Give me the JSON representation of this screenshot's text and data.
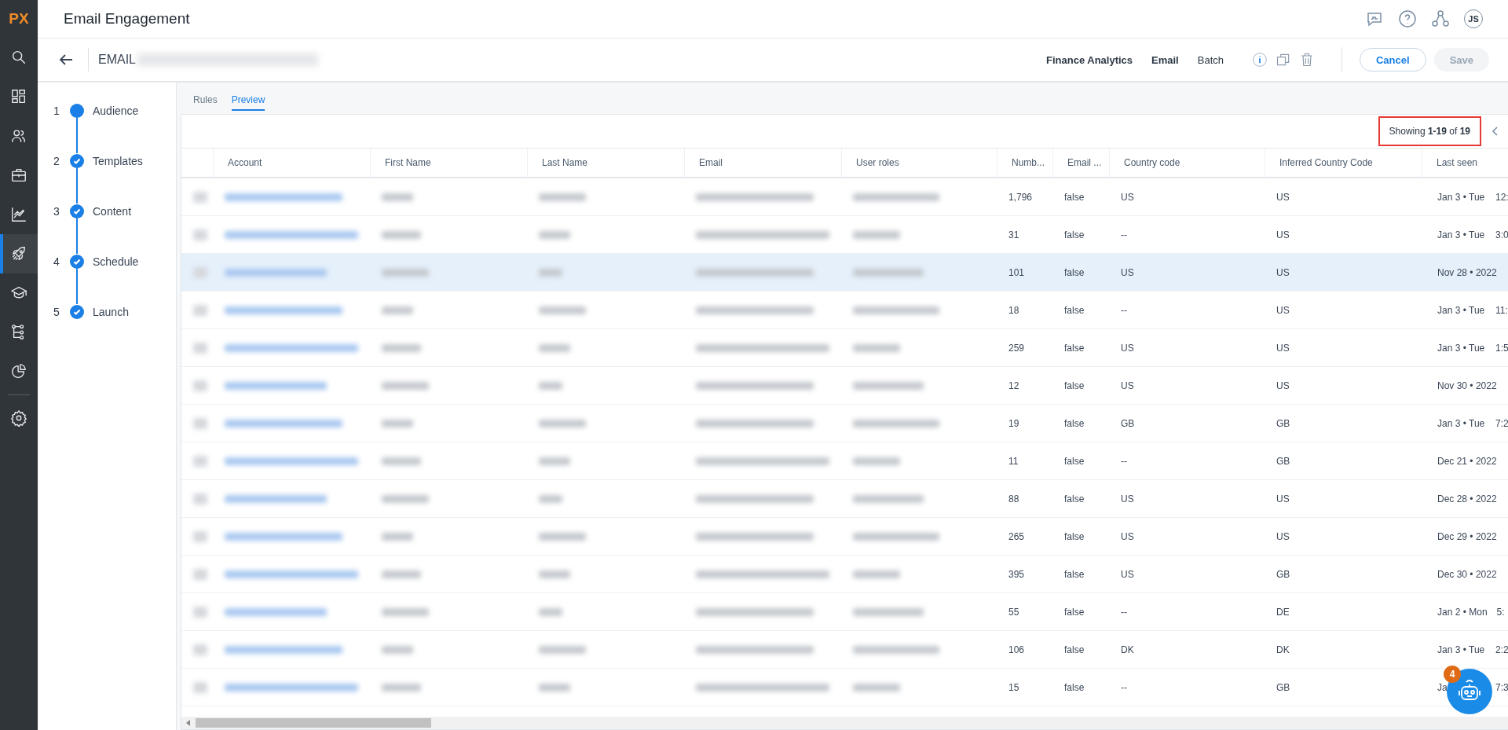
{
  "logo": "PX",
  "sidebar": {
    "items": [
      {
        "selected": false
      },
      {
        "selected": false
      },
      {
        "selected": false
      },
      {
        "selected": false
      },
      {
        "selected": false
      },
      {
        "selected": true
      },
      {
        "selected": false
      },
      {
        "selected": false
      },
      {
        "selected": false
      },
      {
        "selected": false
      }
    ]
  },
  "header": {
    "title": "Email Engagement",
    "avatar": "JS"
  },
  "subheader": {
    "name": "EMAIL",
    "tags": [
      {
        "label": "Finance Analytics",
        "bold": true
      },
      {
        "label": "Email",
        "bold": true
      },
      {
        "label": "Batch",
        "bold": false
      }
    ],
    "cancel": "Cancel",
    "save": {
      "label": "Save",
      "disabled": true
    }
  },
  "steps": [
    {
      "number": "1",
      "label": "Audience",
      "done": false
    },
    {
      "number": "2",
      "label": "Templates",
      "done": true
    },
    {
      "number": "3",
      "label": "Content",
      "done": true
    },
    {
      "number": "4",
      "label": "Schedule",
      "done": true
    },
    {
      "number": "5",
      "label": "Launch",
      "done": true
    }
  ],
  "tabs": [
    {
      "label": "Rules",
      "selected": false
    },
    {
      "label": "Preview",
      "selected": true
    }
  ],
  "table": {
    "summary": "Showing **1-19** of **19**",
    "columns": [
      "Account",
      "First Name",
      "Last Name",
      "Email",
      "User roles",
      "Numb...",
      "Email ...",
      "Country code",
      "Inferred Country Code",
      "Last seen"
    ],
    "rows": [
      {
        "number": "1,796",
        "email_flag": "false",
        "country": "US",
        "inferred": "US",
        "date": "Jan 3 • Tue",
        "time": "12:",
        "highlighted": false
      },
      {
        "number": "31",
        "email_flag": "false",
        "country": "--",
        "inferred": "US",
        "date": "Jan 3 • Tue",
        "time": "3:0",
        "highlighted": false
      },
      {
        "number": "101",
        "email_flag": "false",
        "country": "US",
        "inferred": "US",
        "date": "Nov 28 • 2022",
        "highlighted": true
      },
      {
        "number": "18",
        "email_flag": "false",
        "country": "--",
        "inferred": "US",
        "date": "Jan 3 • Tue",
        "time": "11:",
        "highlighted": false
      },
      {
        "number": "259",
        "email_flag": "false",
        "country": "US",
        "inferred": "US",
        "date": "Jan 3 • Tue",
        "time": "1:5",
        "highlighted": false
      },
      {
        "number": "12",
        "email_flag": "false",
        "country": "US",
        "inferred": "US",
        "date": "Nov 30 • 2022",
        "highlighted": false
      },
      {
        "number": "19",
        "email_flag": "false",
        "country": "GB",
        "inferred": "GB",
        "date": "Jan 3 • Tue",
        "time": "7:2",
        "highlighted": false
      },
      {
        "number": "11",
        "email_flag": "false",
        "country": "--",
        "inferred": "GB",
        "date": "Dec 21 • 2022",
        "highlighted": false
      },
      {
        "number": "88",
        "email_flag": "false",
        "country": "US",
        "inferred": "US",
        "date": "Dec 28 • 2022",
        "highlighted": false
      },
      {
        "number": "265",
        "email_flag": "false",
        "country": "US",
        "inferred": "US",
        "date": "Dec 29 • 2022",
        "highlighted": false
      },
      {
        "number": "395",
        "email_flag": "false",
        "country": "US",
        "inferred": "GB",
        "date": "Dec 30 • 2022",
        "highlighted": false
      },
      {
        "number": "55",
        "email_flag": "false",
        "country": "--",
        "inferred": "DE",
        "date": "Jan 2 • Mon",
        "time": "5:",
        "highlighted": false
      },
      {
        "number": "106",
        "email_flag": "false",
        "country": "DK",
        "inferred": "DK",
        "date": "Jan 3 • Tue",
        "time": "2:2",
        "highlighted": false
      },
      {
        "number": "15",
        "email_flag": "false",
        "country": "--",
        "inferred": "GB",
        "date": "Ja",
        "time": "7:3",
        "highlighted": false
      }
    ]
  },
  "assistant": {
    "badge": "4"
  }
}
